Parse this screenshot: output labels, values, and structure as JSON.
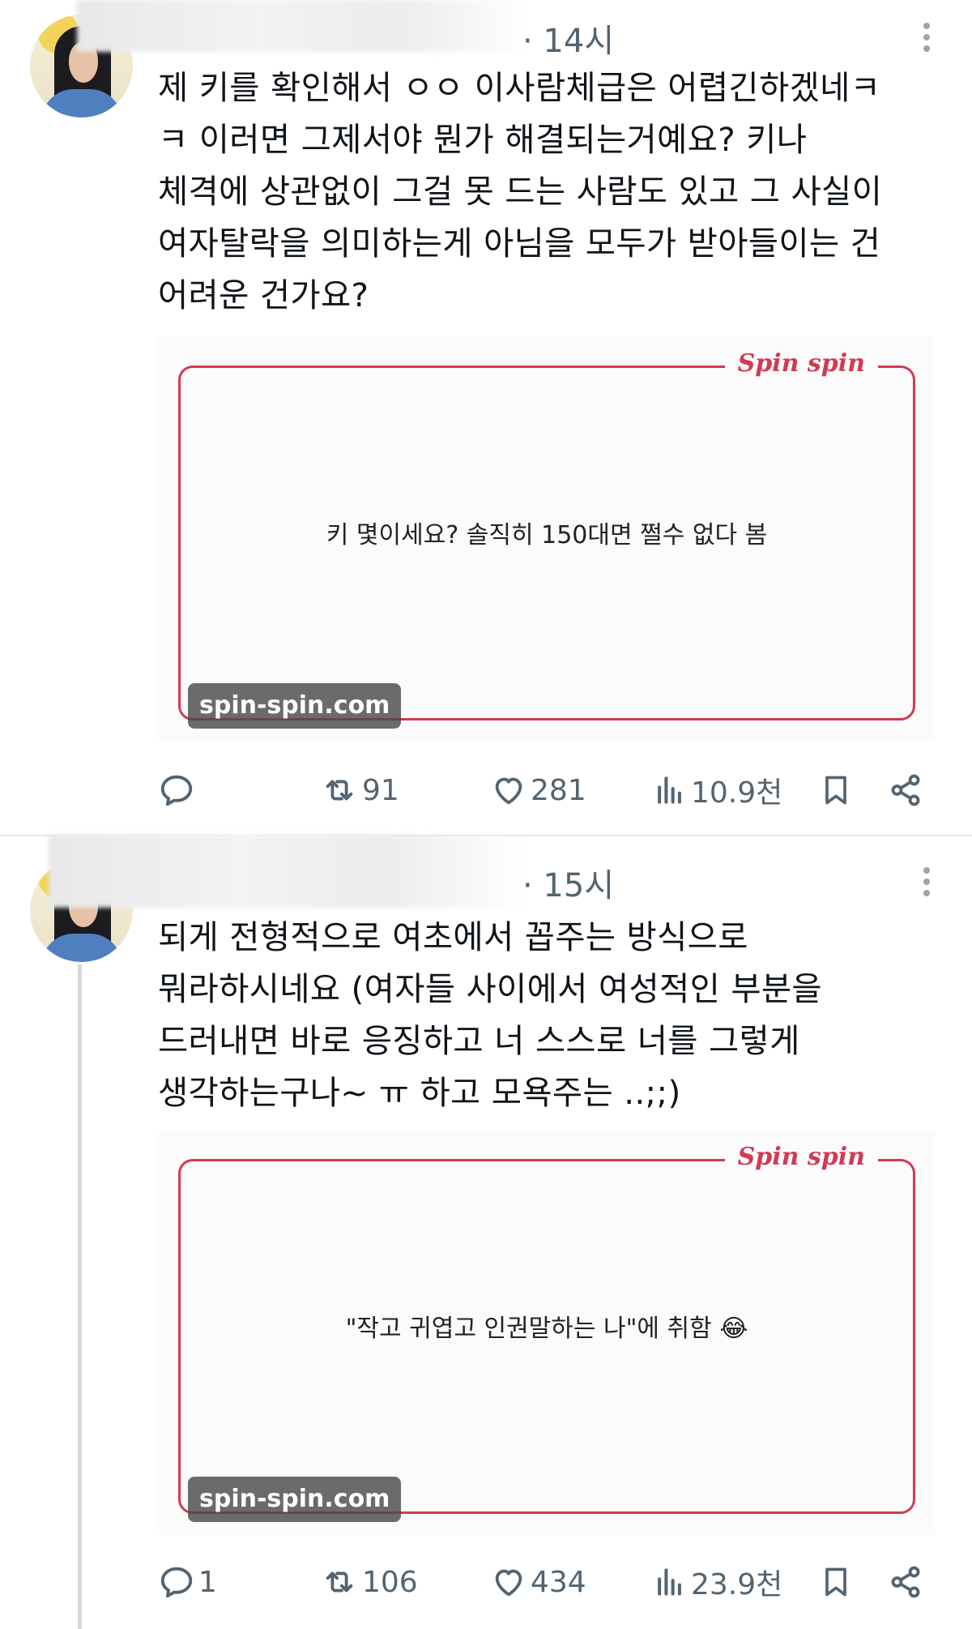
{
  "tweets": [
    {
      "time": "· 14시",
      "text": "제 키를 확인해서 ㅇㅇ 이사람체급은 어렵긴하겠네ㅋ\nㅋ 이러면 그제서야 뭔가 해결되는거예요? 키나\n체격에 상관없이 그걸 못 드는 사람도 있고 그 사실이\n여자탈락을 의미하는게 아님을 모두가 받아들이는 건\n어려운 건가요?",
      "card": {
        "logo": "Spin spin",
        "quote": "키 몇이세요? 솔직히 150대면 쩔수 없다 봄",
        "emoji": "",
        "domain": "spin-spin.com"
      },
      "actions": {
        "replies": "",
        "retweets": "91",
        "likes": "281",
        "views": "10.9천"
      }
    },
    {
      "time": "· 15시",
      "text": "되게 전형적으로 여초에서 꼽주는 방식으로\n뭐라하시네요 (여자들 사이에서 여성적인 부분을\n드러내면 바로 응징하고 너 스스로 너를 그렇게\n생각하는구나~ ㅠ 하고 모욕주는 ..;;)",
      "card": {
        "logo": "Spin spin",
        "quote": "\"작고 귀엽고 인권말하는 나\"에 취함",
        "emoji": "😂",
        "domain": "spin-spin.com"
      },
      "actions": {
        "replies": "1",
        "retweets": "106",
        "likes": "434",
        "views": "23.9천"
      }
    }
  ]
}
